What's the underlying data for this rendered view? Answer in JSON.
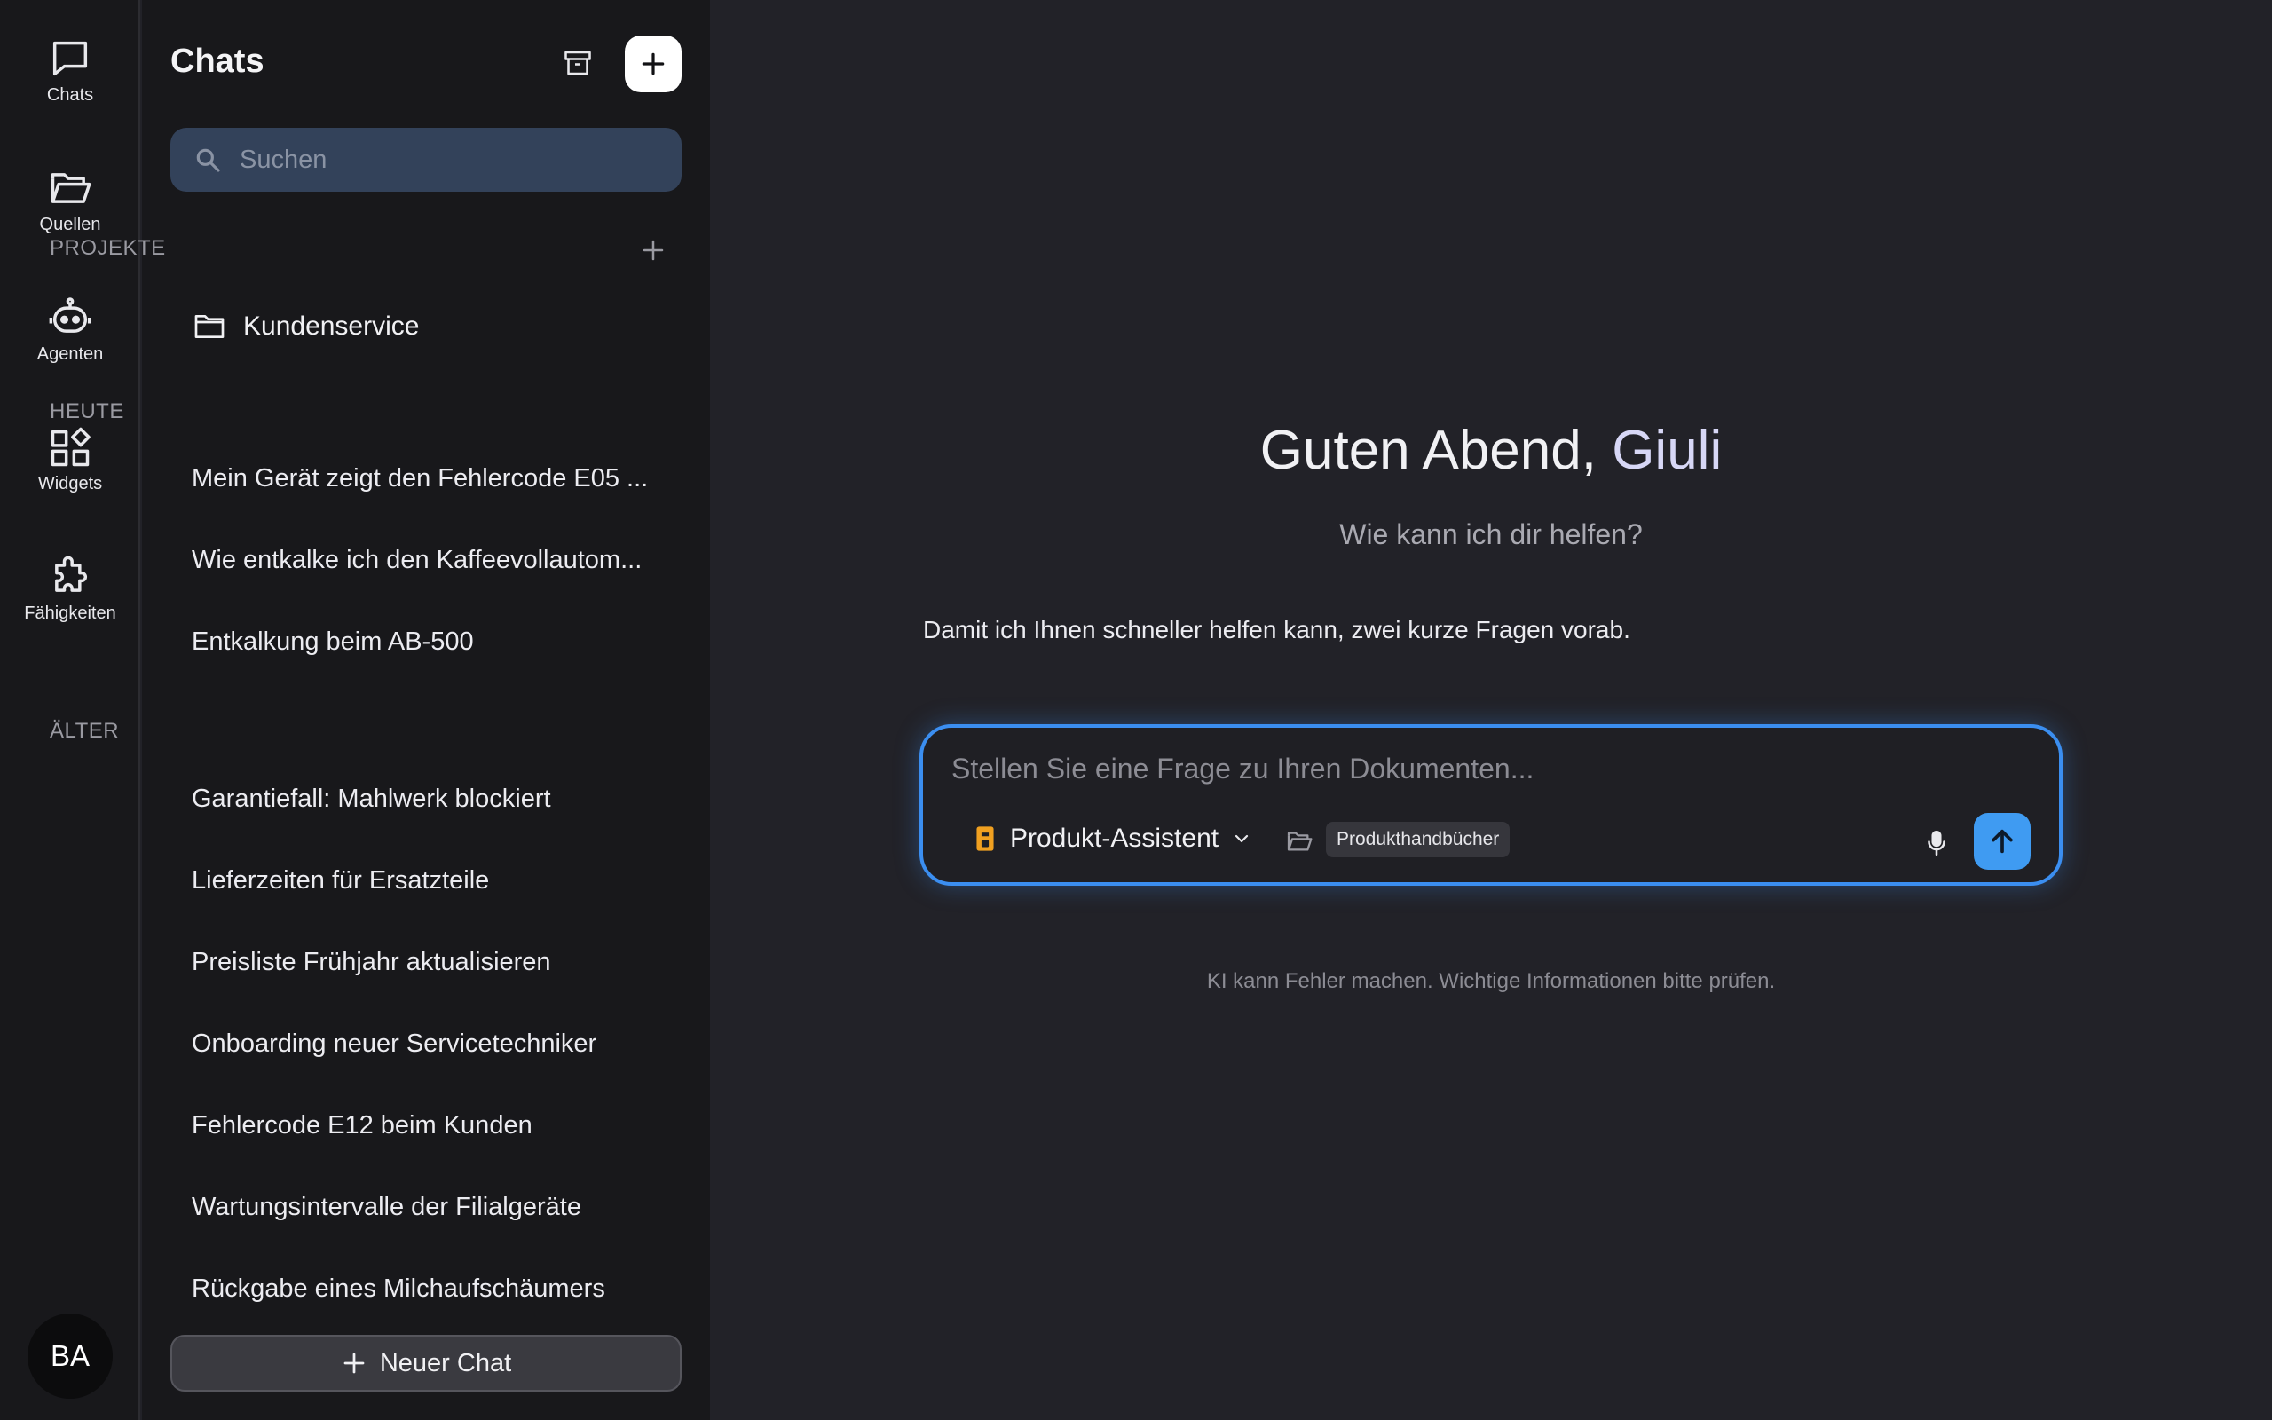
{
  "rail": {
    "items": [
      {
        "label": "Chats",
        "icon": "chat-bubble-icon"
      },
      {
        "label": "Quellen",
        "icon": "folder-open-icon"
      },
      {
        "label": "Agenten",
        "icon": "robot-icon"
      },
      {
        "label": "Widgets",
        "icon": "widgets-icon"
      },
      {
        "label": "Fähigkeiten",
        "icon": "puzzle-icon"
      }
    ],
    "avatar_initials": "BA"
  },
  "panel": {
    "title": "Chats",
    "search_placeholder": "Suchen",
    "projects_label": "PROJEKTE",
    "projects": [
      {
        "label": "Kundenservice"
      }
    ],
    "today_label": "HEUTE",
    "today_chats": [
      {
        "title": "Mein Gerät zeigt den Fehlercode E05 ..."
      },
      {
        "title": "Wie entkalke ich den Kaffeevollautom..."
      },
      {
        "title": "Entkalkung beim AB-500"
      }
    ],
    "older_label": "ÄLTER",
    "older_chats": [
      {
        "title": "Garantiefall: Mahlwerk blockiert"
      },
      {
        "title": "Lieferzeiten für Ersatzteile"
      },
      {
        "title": "Preisliste Frühjahr aktualisieren"
      },
      {
        "title": "Onboarding neuer Servicetechniker"
      },
      {
        "title": "Fehlercode E12 beim Kunden"
      },
      {
        "title": "Wartungsintervalle der Filialgeräte"
      },
      {
        "title": "Rückgabe eines Milchaufschäumers"
      }
    ],
    "new_chat_label": "Neuer Chat"
  },
  "main": {
    "greeting_prefix": "Guten Abend, ",
    "greeting_name": "Giuli",
    "subtitle": "Wie kann ich dir helfen?",
    "intro": "Damit ich Ihnen schneller helfen kann, zwei kurze Fragen vorab.",
    "composer": {
      "placeholder": "Stellen Sie eine Frage zu Ihren Dokumenten...",
      "value": "",
      "agent_label": "Produkt-Assistent",
      "source_label": "Produkthandbücher"
    },
    "disclaimer": "KI kann Fehler machen. Wichtige Informationen bitte prüfen."
  },
  "colors": {
    "accent": "#3b8ef0",
    "send_button": "#3f9bf2",
    "search_bg": "#33425a",
    "agent_icon": "#f0a020"
  }
}
